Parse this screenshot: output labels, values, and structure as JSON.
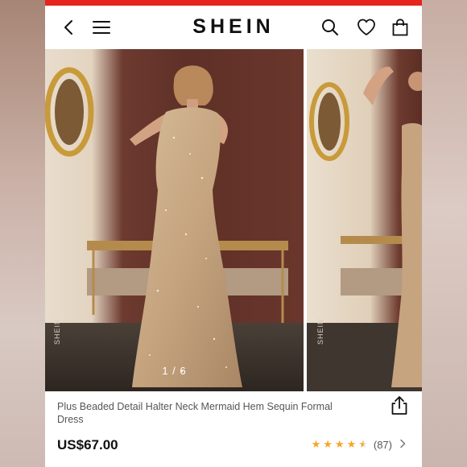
{
  "header": {
    "brand": "SHEIN",
    "icons": [
      "back-icon",
      "menu-icon",
      "search-icon",
      "heart-icon",
      "bag-icon"
    ],
    "accent_color": "#e5251e"
  },
  "gallery": {
    "pager": "1 / 6",
    "watermark": "SHEIN",
    "current_index": 1,
    "total": 6
  },
  "product": {
    "title": "Plus Beaded Detail Halter Neck Mermaid Hem Sequin Formal Dress",
    "price": "US$67.00",
    "rating": 4.5,
    "review_count": "(87)",
    "star_color": "#f6a623"
  }
}
